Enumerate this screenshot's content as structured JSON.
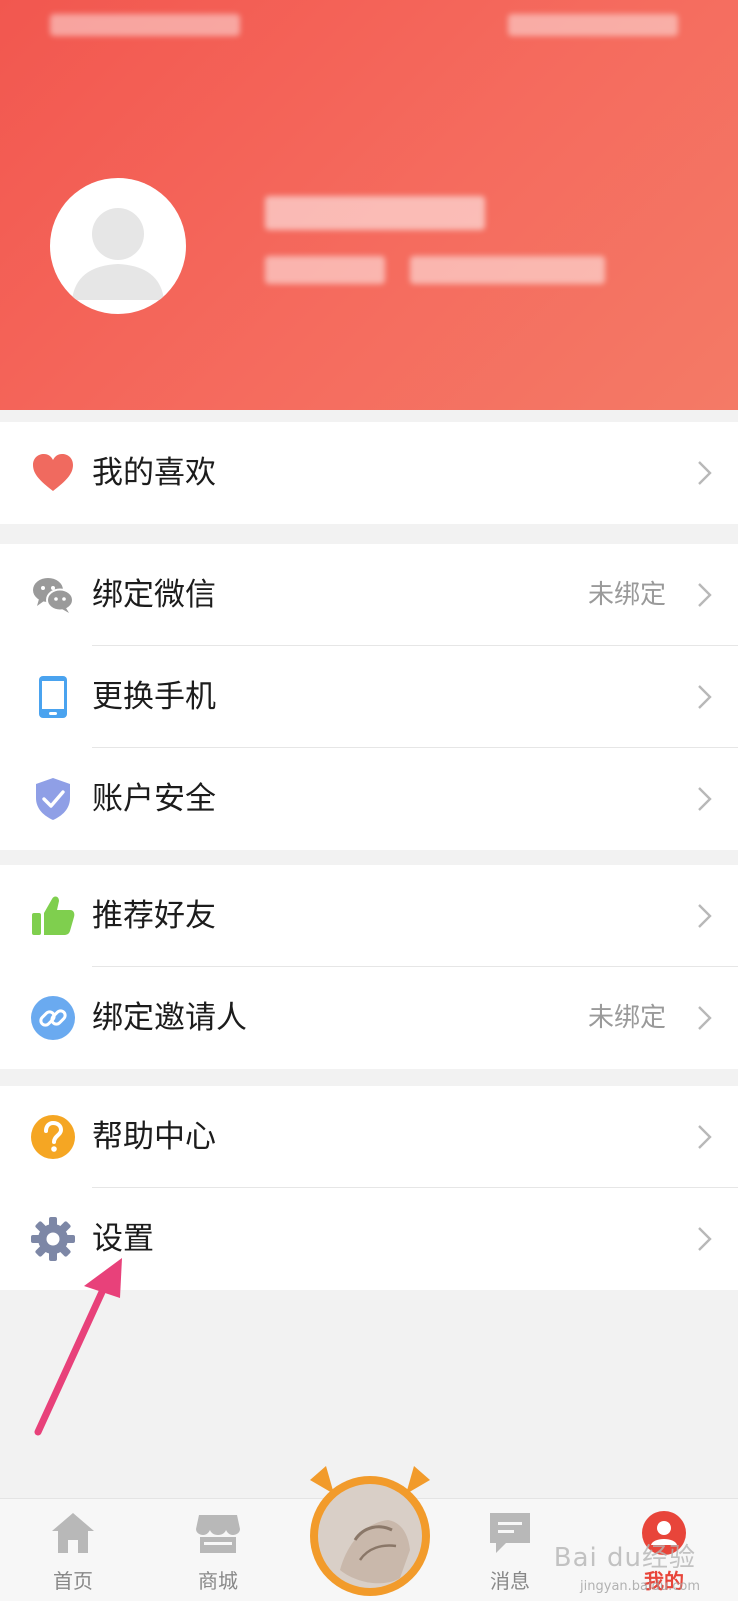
{
  "menu": {
    "favorites": {
      "label": "我的喜欢"
    },
    "bind_wechat": {
      "label": "绑定微信",
      "value": "未绑定"
    },
    "change_phone": {
      "label": "更换手机"
    },
    "account_security": {
      "label": "账户安全"
    },
    "recommend_friends": {
      "label": "推荐好友"
    },
    "bind_inviter": {
      "label": "绑定邀请人",
      "value": "未绑定"
    },
    "help_center": {
      "label": "帮助中心"
    },
    "settings": {
      "label": "设置"
    }
  },
  "tabbar": {
    "home": "首页",
    "mall": "商城",
    "messages": "消息",
    "mine": "我的"
  },
  "watermark": {
    "brand": "Bai du经验",
    "url": "jingyan.baidu.com"
  },
  "colors": {
    "header_gradient_start": "#f2574f",
    "header_gradient_end": "#f47a66",
    "active_tab": "#e8453a",
    "annotation_arrow": "#e8417a"
  }
}
